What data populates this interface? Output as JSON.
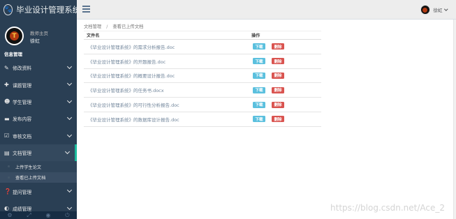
{
  "sidebar": {
    "brand_title": "毕业设计管理系统",
    "brand_logo_glyph": "🐾",
    "profile": {
      "welcome": "教师主页",
      "name": "徐虹",
      "avatar_glyph": "T"
    },
    "section_title": "信息管理",
    "items": [
      {
        "label": "修改资料",
        "icon": "✎"
      },
      {
        "label": "课题管理",
        "icon": "✚"
      },
      {
        "label": "学生管理",
        "icon": "☻"
      },
      {
        "label": "发布内容",
        "icon": "▬"
      },
      {
        "label": "审核文档",
        "icon": "☑"
      },
      {
        "label": "文档管理",
        "icon": "▤"
      }
    ],
    "submenu": [
      {
        "label": "上传学生论文"
      },
      {
        "label": "查看已上传文档"
      }
    ],
    "items_after": [
      {
        "label": "提问管理",
        "icon": "❓"
      },
      {
        "label": "成绩管理",
        "icon": "◐"
      }
    ],
    "footer_icons": [
      "⚙",
      "⤢",
      "◉",
      "⏻"
    ]
  },
  "topnav": {
    "user_name": "徐虹"
  },
  "breadcrumb": {
    "root": "文档管理",
    "separator": "/",
    "current": "查看已上传文档"
  },
  "table": {
    "headers": {
      "name": "文件名",
      "op": "操作"
    },
    "rows": [
      {
        "name": "《毕业设计管理系统》的需求分析报告.doc"
      },
      {
        "name": "《毕业设计管理系统》的开题报告.doc"
      },
      {
        "name": "《毕业设计管理系统》的概要设计报告.doc"
      },
      {
        "name": "《毕业设计管理系统》的任务书.docx"
      },
      {
        "name": "《毕业设计管理系统》的可行性分析报告.doc"
      },
      {
        "name": "《毕业设计管理系统》的数据库设计报告.doc"
      }
    ],
    "download_label": "下载",
    "delete_label": "删除"
  },
  "watermark": "https://blog.csdn.net/Ace_2",
  "colors": {
    "sidebar_bg": "#2a3f54",
    "active_border": "#1abb9c",
    "download": "#5bc0de",
    "delete": "#d9534f"
  }
}
